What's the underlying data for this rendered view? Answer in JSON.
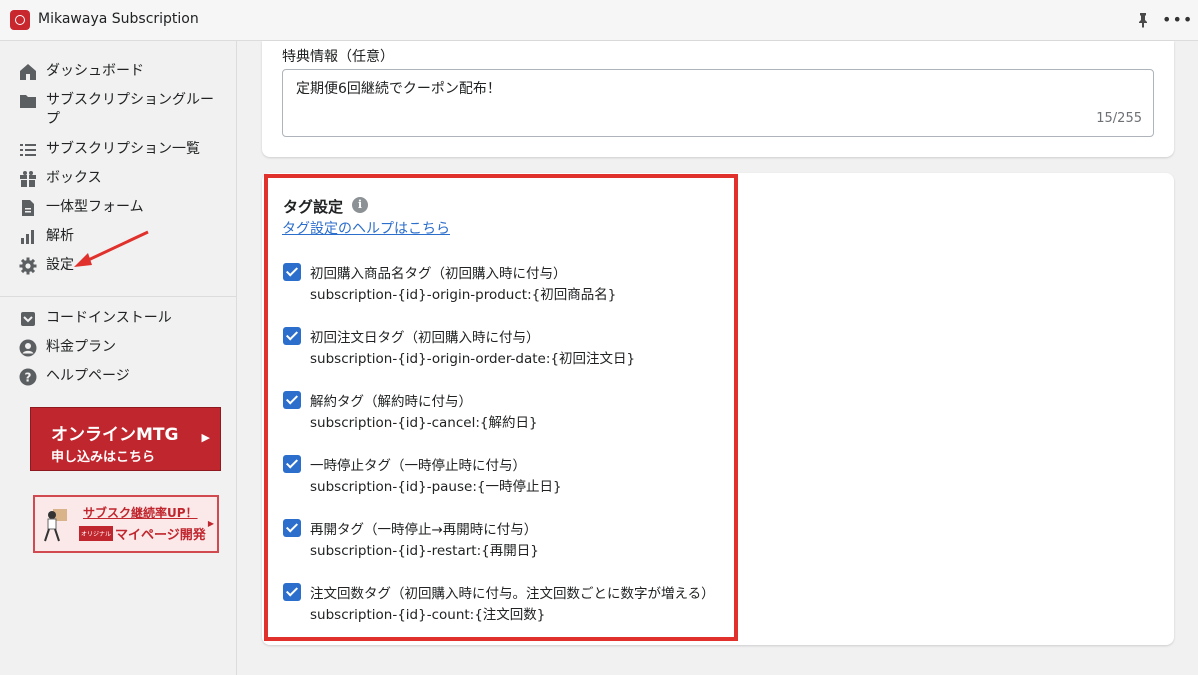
{
  "app": {
    "title": "Mikawaya Subscription"
  },
  "sidebar": {
    "items": [
      {
        "label": "ダッシュボード",
        "icon": "home-icon"
      },
      {
        "label": "サブスクリプショングループ",
        "icon": "folder-icon"
      },
      {
        "label": "サブスクリプション一覧",
        "icon": "list-icon"
      },
      {
        "label": "ボックス",
        "icon": "gift-icon"
      },
      {
        "label": "一体型フォーム",
        "icon": "document-icon"
      },
      {
        "label": "解析",
        "icon": "bar-chart-icon"
      },
      {
        "label": "設定",
        "icon": "gear-icon"
      }
    ],
    "secondary": [
      {
        "label": "コードインストール",
        "icon": "install-icon"
      },
      {
        "label": "料金プラン",
        "icon": "user-icon"
      },
      {
        "label": "ヘルプページ",
        "icon": "help-icon"
      }
    ],
    "banner_mtg": {
      "line1": "オンラインMTG",
      "line2": "申し込みはこちら"
    },
    "banner_mypage": {
      "line1": "サブスク継続率UP！",
      "badge": "オリジナル",
      "line2": "マイページ開発"
    }
  },
  "benefit": {
    "label": "特典情報（任意）",
    "value": "定期便6回継続でクーポン配布！",
    "count": "15/255"
  },
  "tags": {
    "title": "タグ設定",
    "help_link": "タグ設定のヘルプはこちら",
    "options": [
      {
        "title": "初回購入商品名タグ（初回購入時に付与）",
        "tag": "subscription-{id}-origin-product:{初回商品名}",
        "checked": true
      },
      {
        "title": "初回注文日タグ（初回購入時に付与）",
        "tag": "subscription-{id}-origin-order-date:{初回注文日}",
        "checked": true
      },
      {
        "title": "解約タグ（解約時に付与）",
        "tag": "subscription-{id}-cancel:{解約日}",
        "checked": true
      },
      {
        "title": "一時停止タグ（一時停止時に付与）",
        "tag": "subscription-{id}-pause:{一時停止日}",
        "checked": true
      },
      {
        "title": "再開タグ（一時停止→再開時に付与）",
        "tag": "subscription-{id}-restart:{再開日}",
        "checked": true
      },
      {
        "title": "注文回数タグ（初回購入時に付与。注文回数ごとに数字が増える）",
        "tag": "subscription-{id}-count:{注文回数}",
        "checked": true
      }
    ]
  },
  "colors": {
    "accent": "#2c6ecb",
    "highlight": "#e0312c",
    "brand": "#c0262d"
  }
}
